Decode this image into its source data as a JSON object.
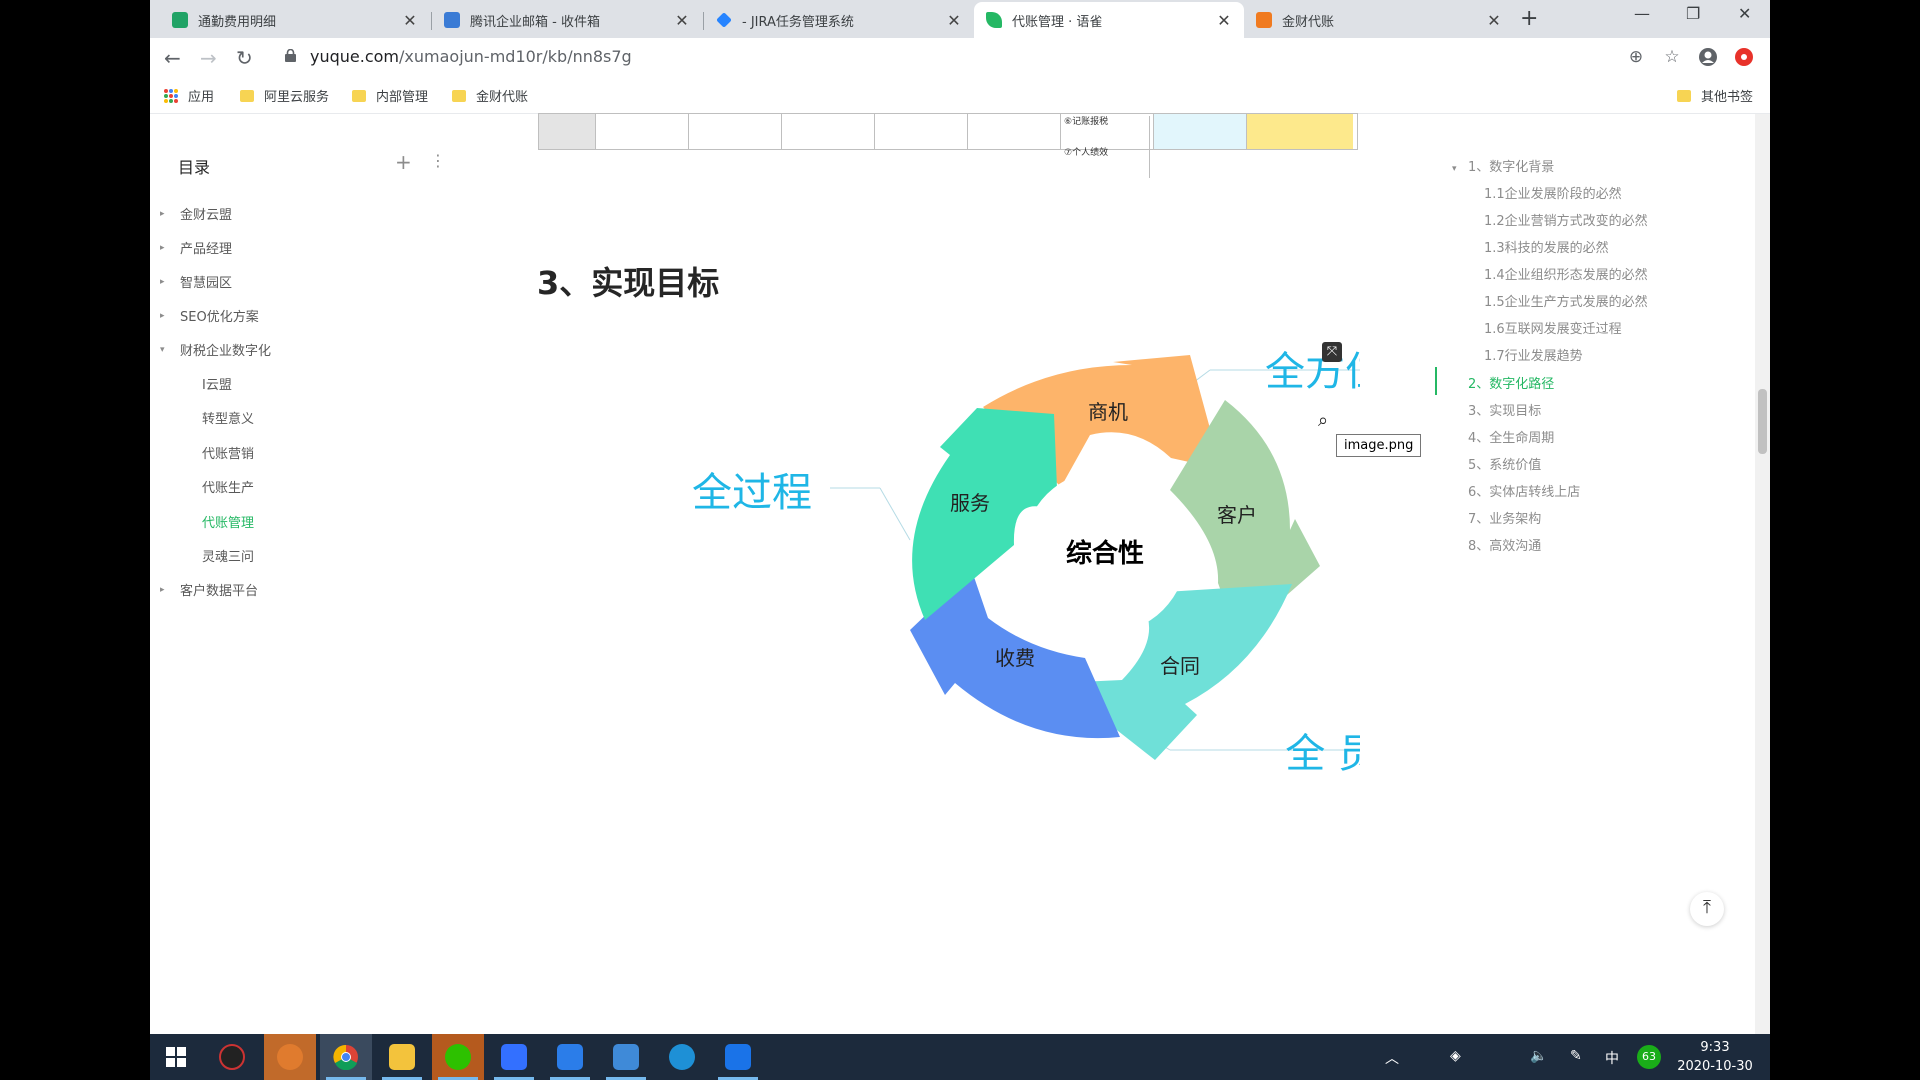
{
  "browser": {
    "tabs": [
      {
        "label": "通勤费用明细",
        "color": "#21a366"
      },
      {
        "label": "腾讯企业邮箱 - 收件箱",
        "color": "#3a7bd5"
      },
      {
        "label": "- JIRA任务管理系统",
        "color": "#2684ff"
      },
      {
        "label": "代账管理 · 语雀",
        "color": "#25b864"
      },
      {
        "label": "金财代账",
        "color": "#f07a1f"
      }
    ],
    "url_host": "yuque.com",
    "url_path": "/xumaojun-md10r/kb/nn8s7g",
    "bookmarks": [
      "应用",
      "阿里云服务",
      "内部管理",
      "金财代账"
    ],
    "other_bookmarks": "其他书签"
  },
  "sidebar": {
    "title": "目录",
    "items": [
      {
        "label": "金财云盟",
        "caret": "▸"
      },
      {
        "label": "产品经理",
        "caret": "▸"
      },
      {
        "label": "智慧园区",
        "caret": "▸"
      },
      {
        "label": "SEO优化方案",
        "caret": "▸"
      },
      {
        "label": "财税企业数字化",
        "caret": "▾"
      },
      {
        "label": "I云盟",
        "caret": ""
      },
      {
        "label": "转型意义",
        "caret": ""
      },
      {
        "label": "代账营销",
        "caret": ""
      },
      {
        "label": "代账生产",
        "caret": ""
      },
      {
        "label": "代账管理",
        "caret": ""
      },
      {
        "label": "灵魂三问",
        "caret": ""
      },
      {
        "label": "客户数据平台",
        "caret": "▸"
      }
    ]
  },
  "content": {
    "table_note_1": "⑥记账报税",
    "table_note_2": "⑦个人绩效",
    "heading": "3、实现目标",
    "diagram": {
      "center": "综合性",
      "segments": [
        "商机",
        "客户",
        "合同",
        "收费",
        "服务"
      ],
      "callouts": [
        "全方位",
        "全过程",
        "全 员"
      ],
      "segment_colors": [
        "#fdb46a",
        "#a9d4a9",
        "#6fe0d8",
        "#5b8ef2",
        "#3fe0b4"
      ],
      "callout_color": "#1fb6e6"
    },
    "tooltip": "image.png"
  },
  "toc": {
    "items": [
      {
        "label": "1、数字化背景",
        "level": 1
      },
      {
        "label": "1.1企业发展阶段的必然",
        "level": 2
      },
      {
        "label": "1.2企业营销方式改变的必然",
        "level": 2
      },
      {
        "label": "1.3科技的发展的必然",
        "level": 2
      },
      {
        "label": "1.4企业组织形态发展的必然",
        "level": 2
      },
      {
        "label": "1.5企业生产方式发展的必然",
        "level": 2
      },
      {
        "label": "1.6互联网发展变迁过程",
        "level": 2
      },
      {
        "label": "1.7行业发展趋势",
        "level": 2
      },
      {
        "label": "2、数字化路径",
        "level": 1,
        "active": true
      },
      {
        "label": "3、实现目标",
        "level": 1
      },
      {
        "label": "4、全生命周期",
        "level": 1
      },
      {
        "label": "5、系统价值",
        "level": 1
      },
      {
        "label": "6、实体店转线上店",
        "level": 1
      },
      {
        "label": "7、业务架构",
        "level": 1
      },
      {
        "label": "8、高效沟通",
        "level": 1
      }
    ]
  },
  "taskbar": {
    "time": "9:33",
    "date": "2020-10-30",
    "ime": "中",
    "badge": "63"
  }
}
